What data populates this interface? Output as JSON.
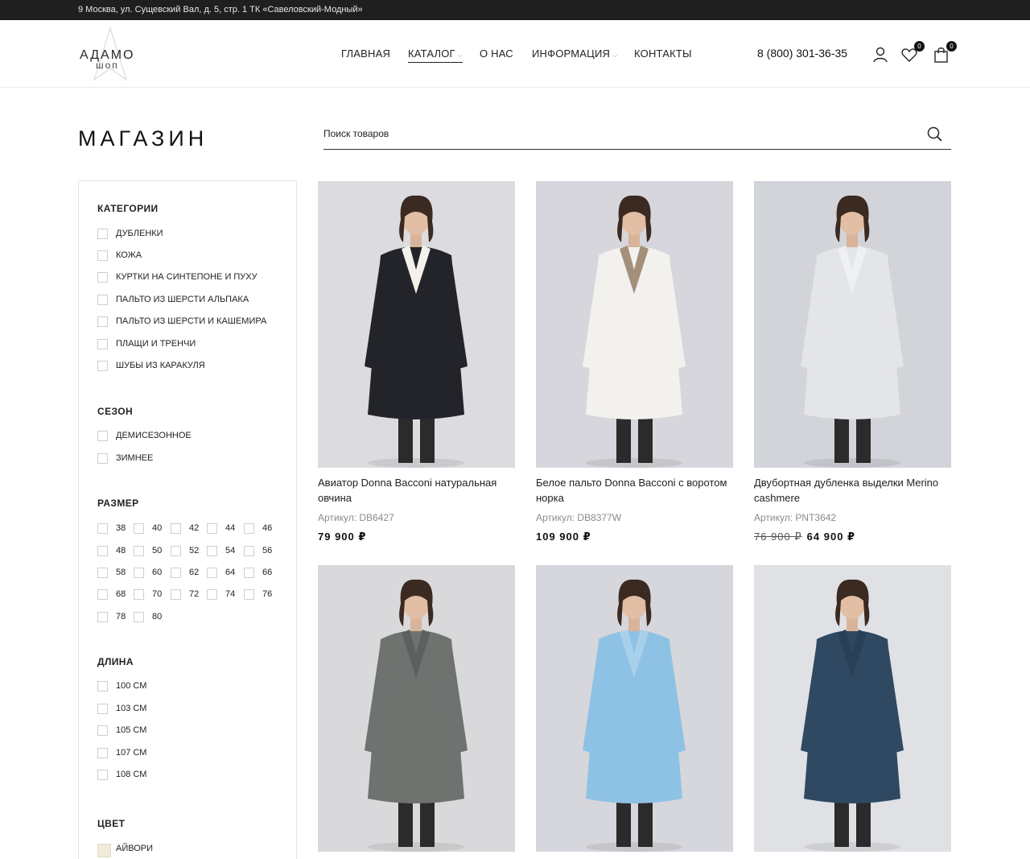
{
  "topbar": {
    "address": "9 Москва, ул. Сущевский Вал, д. 5, стр. 1 ТК «Савеловский-Модный»"
  },
  "brand": {
    "line1": "АДАМО",
    "line2": "шоп"
  },
  "nav": [
    {
      "label": "ГЛАВНАЯ"
    },
    {
      "label": "КАТАЛОГ"
    },
    {
      "label": "О НАС"
    },
    {
      "label": "ИНФОРМАЦИЯ"
    },
    {
      "label": "КОНТАКТЫ"
    }
  ],
  "header": {
    "phone": "8 (800) 301-36-35",
    "wishlist_count": "0",
    "cart_count": "0"
  },
  "page": {
    "title": "МАГАЗИН"
  },
  "search": {
    "placeholder": "Поиск товаров"
  },
  "filters": {
    "categories": {
      "title": "КАТЕГОРИИ",
      "items": [
        "ДУБЛЕНКИ",
        "КОЖА",
        "КУРТКИ НА СИНТЕПОНЕ И ПУХУ",
        "ПАЛЬТО ИЗ ШЕРСТИ АЛЬПАКА",
        "ПАЛЬТО ИЗ ШЕРСТИ И КАШЕМИРА",
        "ПЛАЩИ И ТРЕНЧИ",
        "ШУБЫ ИЗ КАРАКУЛЯ"
      ]
    },
    "season": {
      "title": "СЕЗОН",
      "items": [
        "ДЕМИСЕЗОННОЕ",
        "ЗИМНЕЕ"
      ]
    },
    "size": {
      "title": "РАЗМЕР",
      "items": [
        "38",
        "40",
        "42",
        "44",
        "46",
        "48",
        "50",
        "52",
        "54",
        "56",
        "58",
        "60",
        "62",
        "64",
        "66",
        "68",
        "70",
        "72",
        "74",
        "76",
        "78",
        "80"
      ]
    },
    "length": {
      "title": "ДЛИНА",
      "items": [
        "100 СМ",
        "103 СМ",
        "105 СМ",
        "107 СМ",
        "108 СМ"
      ]
    },
    "color": {
      "title": "ЦВЕТ",
      "items": [
        {
          "label": "АЙВОРИ",
          "swatch": "#f1ead9"
        }
      ]
    }
  },
  "products": [
    {
      "name": "Авиатор Donna Bacconi натуральная овчина",
      "sku": "Артикул: DB6427",
      "price": "79 900 ₽",
      "old_price": "",
      "coat": "#23242a",
      "trim": "#f4f1ea",
      "bg": "#dcdbe0"
    },
    {
      "name": "Белое пальто Donna Bacconi с воротом норка",
      "sku": "Артикул: DB8377W",
      "price": "109 900 ₽",
      "old_price": "",
      "coat": "#f2f1ee",
      "trim": "#a48f7b",
      "bg": "#d7d6dc"
    },
    {
      "name": "Двубортная дубленка выделки Merino cashmere",
      "sku": "Артикул: PNT3642",
      "price": "64 900 ₽",
      "old_price": "76 900 ₽",
      "coat": "#e4e5e9",
      "trim": "#eef0f3",
      "bg": "#d2d4d9"
    },
    {
      "name": "",
      "sku": "",
      "price": "",
      "old_price": "",
      "coat": "#6f7370",
      "trim": "#5d605e",
      "bg": "#d9d9dc"
    },
    {
      "name": "",
      "sku": "",
      "price": "",
      "old_price": "",
      "coat": "#8ec2e4",
      "trim": "#a7d0ea",
      "bg": "#d6d7dc"
    },
    {
      "name": "",
      "sku": "",
      "price": "",
      "old_price": "",
      "coat": "#2f4962",
      "trim": "#2a4058",
      "bg": "#e0e1e5"
    }
  ]
}
